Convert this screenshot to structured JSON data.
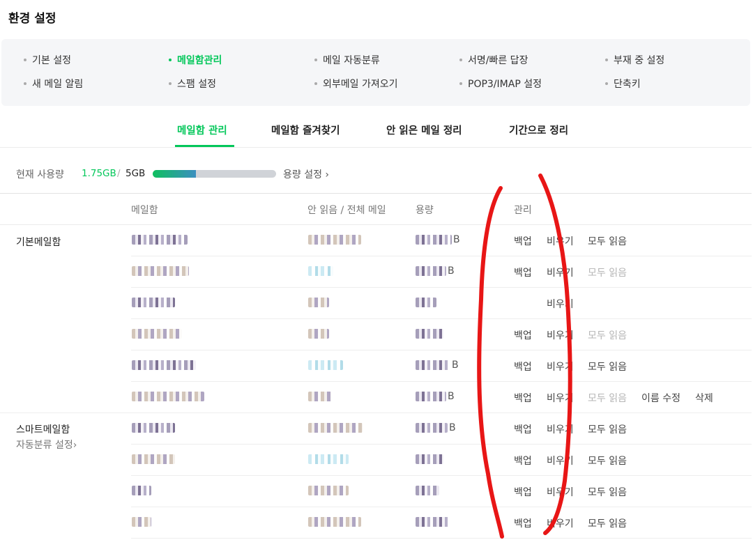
{
  "page": {
    "title": "환경 설정"
  },
  "settings_nav": [
    {
      "label": "기본 설정",
      "active": false
    },
    {
      "label": "메일함관리",
      "active": true
    },
    {
      "label": "메일 자동분류",
      "active": false
    },
    {
      "label": "서명/빠른 답장",
      "active": false
    },
    {
      "label": "부재 중 설정",
      "active": false
    },
    {
      "label": "새 메일 알림",
      "active": false
    },
    {
      "label": "스팸 설정",
      "active": false
    },
    {
      "label": "외부메일 가져오기",
      "active": false
    },
    {
      "label": "POP3/IMAP 설정",
      "active": false
    },
    {
      "label": "단축키",
      "active": false
    }
  ],
  "tabs": [
    {
      "label": "메일함 관리",
      "active": true
    },
    {
      "label": "메일함 즐겨찾기",
      "active": false
    },
    {
      "label": "안 읽은 메일 정리",
      "active": false
    },
    {
      "label": "기간으로 정리",
      "active": false
    }
  ],
  "usage": {
    "label": "현재 사용량",
    "used": "1.75GB",
    "separator": "/",
    "total": "5GB",
    "fraction": 0.35,
    "setting_label": "용량 설정 ›"
  },
  "columns": {
    "mailbox": "메일함",
    "unread_total": "안 읽음 / 전체 메일",
    "size": "용량",
    "manage": "관리"
  },
  "groups": [
    {
      "label": "기본메일함"
    },
    {
      "label": "스마트메일함",
      "sub_label": "자동분류 설정›"
    }
  ],
  "actions": {
    "backup": "백업",
    "empty": "비우기",
    "read_all": "모두 읽음",
    "rename": "이름 수정",
    "delete": "삭제"
  },
  "rows": [
    {
      "size_suffix": "B",
      "backup": true,
      "empty": true,
      "read_all": "enabled"
    },
    {
      "size_suffix": "B",
      "backup": true,
      "empty": true,
      "read_all": "disabled"
    },
    {
      "size_suffix": "",
      "backup": false,
      "empty": true,
      "read_all": "none"
    },
    {
      "size_suffix": "",
      "backup": true,
      "empty": true,
      "read_all": "disabled"
    },
    {
      "size_suffix": "B",
      "backup": true,
      "empty": true,
      "read_all": "enabled"
    },
    {
      "size_suffix": "B",
      "backup": true,
      "empty": true,
      "read_all": "disabled",
      "rename": true,
      "delete": true
    },
    {
      "size_suffix": "B",
      "backup": true,
      "empty": true,
      "read_all": "enabled"
    },
    {
      "size_suffix": "",
      "backup": true,
      "empty": true,
      "read_all": "enabled"
    },
    {
      "size_suffix": "",
      "backup": true,
      "empty": true,
      "read_all": "enabled"
    },
    {
      "size_suffix": "",
      "backup": true,
      "empty": true,
      "read_all": "enabled"
    }
  ],
  "colors": {
    "accent": "#03c75a",
    "annotation": "#e81616"
  }
}
